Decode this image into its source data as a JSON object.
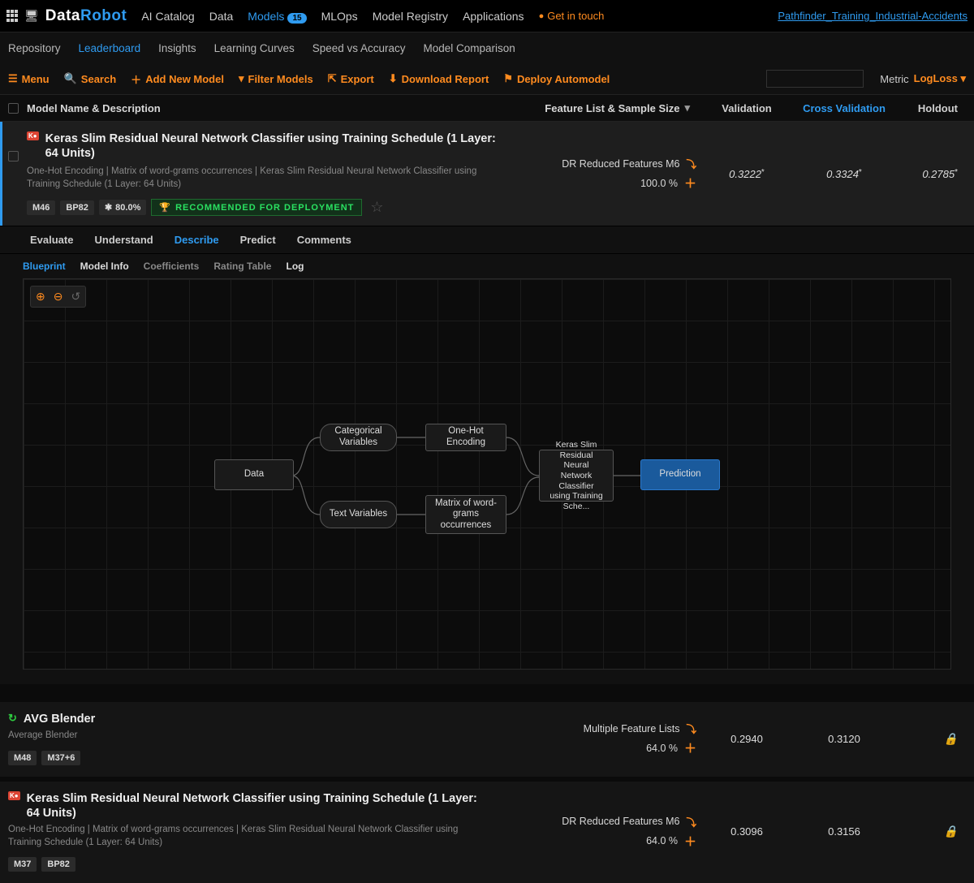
{
  "header": {
    "logo_white": "Data",
    "logo_blue": "Robot",
    "nav": {
      "catalog": "AI Catalog",
      "data": "Data",
      "models": "Models",
      "models_badge": "15",
      "mlops": "MLOps",
      "registry": "Model Registry",
      "apps": "Applications",
      "contact": "Get in touch"
    },
    "project": "Pathfinder_Training_Industrial-Accidents"
  },
  "subnav": {
    "repository": "Repository",
    "leaderboard": "Leaderboard",
    "insights": "Insights",
    "curves": "Learning Curves",
    "speed": "Speed vs Accuracy",
    "compare": "Model Comparison"
  },
  "toolbar": {
    "menu": "Menu",
    "search": "Search",
    "add": "Add New Model",
    "filter": "Filter Models",
    "export": "Export",
    "download": "Download Report",
    "deploy": "Deploy Automodel",
    "metric_label": "Metric",
    "metric_value": "LogLoss"
  },
  "columns": {
    "name": "Model Name & Description",
    "feat": "Feature List & Sample Size",
    "validation": "Validation",
    "cv": "Cross Validation",
    "holdout": "Holdout"
  },
  "model1": {
    "title": "Keras Slim Residual Neural Network Classifier using Training Schedule (1 Layer: 64 Units)",
    "desc": "One-Hot Encoding | Matrix of word-grams occurrences | Keras Slim Residual Neural Network Classifier using Training Schedule (1 Layer: 64 Units)",
    "tag1": "M46",
    "tag2": "BP82",
    "tag3_pct": "80.0%",
    "recommend": "RECOMMENDED FOR DEPLOYMENT",
    "feat_name": "DR Reduced Features M6",
    "feat_pct": "100.0 %",
    "validation": "0.3222",
    "cv": "0.3324",
    "holdout": "0.2785"
  },
  "tabs": {
    "evaluate": "Evaluate",
    "understand": "Understand",
    "describe": "Describe",
    "predict": "Predict",
    "comments": "Comments"
  },
  "subtabs": {
    "blueprint": "Blueprint",
    "modelinfo": "Model Info",
    "coefficients": "Coefficients",
    "rating": "Rating Table",
    "log": "Log"
  },
  "nodes": {
    "data": "Data",
    "cat": "Categorical Variables",
    "text": "Text Variables",
    "onehot": "One-Hot Encoding",
    "matrix": "Matrix of word-grams occurrences",
    "keras": "Keras Slim Residual Neural Network Classifier using Training Sche...",
    "pred": "Prediction"
  },
  "model2": {
    "title": "AVG Blender",
    "desc": "Average Blender",
    "tag1": "M48",
    "tag2": "M37+6",
    "feat_name": "Multiple Feature Lists",
    "feat_pct": "64.0 %",
    "validation": "0.2940",
    "cv": "0.3120"
  },
  "model3": {
    "title": "Keras Slim Residual Neural Network Classifier using Training Schedule (1 Layer: 64 Units)",
    "desc": "One-Hot Encoding | Matrix of word-grams occurrences | Keras Slim Residual Neural Network Classifier using Training Schedule (1 Layer: 64 Units)",
    "tag1": "M37",
    "tag2": "BP82",
    "feat_name": "DR Reduced Features M6",
    "feat_pct": "64.0 %",
    "validation": "0.3096",
    "cv": "0.3156"
  }
}
